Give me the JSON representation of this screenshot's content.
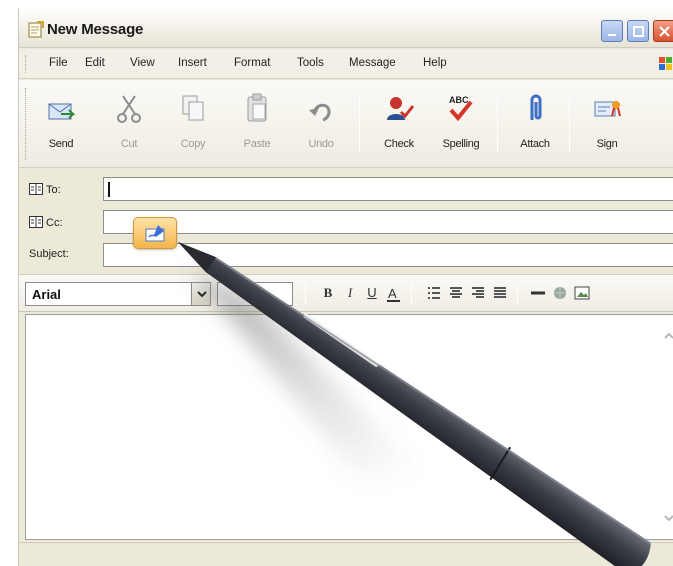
{
  "window": {
    "title": "New Message"
  },
  "menu": [
    "File",
    "Edit",
    "View",
    "Insert",
    "Format",
    "Tools",
    "Message",
    "Help"
  ],
  "toolbar": {
    "buttons": [
      {
        "label": "Send",
        "icon": "send-icon",
        "enabled": true
      },
      {
        "label": "Cut",
        "icon": "scissors-icon",
        "enabled": false
      },
      {
        "label": "Copy",
        "icon": "copy-icon",
        "enabled": false
      },
      {
        "label": "Paste",
        "icon": "paste-icon",
        "enabled": false
      },
      {
        "label": "Undo",
        "icon": "undo-icon",
        "enabled": false
      },
      {
        "label": "Check",
        "icon": "check-names-icon",
        "enabled": true
      },
      {
        "label": "Spelling",
        "icon": "spelling-icon",
        "enabled": true
      },
      {
        "label": "Attach",
        "icon": "paperclip-icon",
        "enabled": true
      },
      {
        "label": "Sign",
        "icon": "sign-icon",
        "enabled": true
      }
    ]
  },
  "headers": {
    "to_label": "To:",
    "cc_label": "Cc:",
    "subject_label": "Subject:",
    "to_value": "",
    "cc_value": "",
    "subject_value": ""
  },
  "format": {
    "font": "Arial",
    "font_size": ""
  },
  "colors": {
    "title_accent": "#3a6fd8",
    "close_red": "#d8512e",
    "pen_body": "#3d3f48",
    "handwriting_badge": "#f3b54a"
  }
}
